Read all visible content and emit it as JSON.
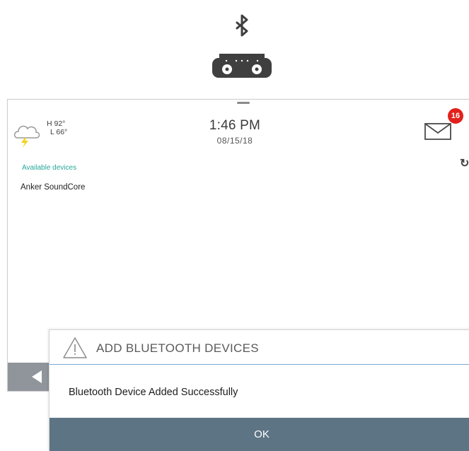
{
  "illustration": {
    "bluetooth_icon": "bluetooth-icon",
    "speaker_icon": "speaker-icon"
  },
  "header": {
    "weather": {
      "icon": "storm-cloud-icon",
      "high": "H 92°",
      "low": "L 66°"
    },
    "time": "1:46 PM",
    "date": "08/15/18",
    "messages": {
      "icon": "envelope-icon",
      "count": "16"
    }
  },
  "devices": {
    "label": "Available devices",
    "items": [
      "Anker SoundCore"
    ]
  },
  "dialog": {
    "icon": "warning-icon",
    "title": "ADD BLUETOOTH DEVICES",
    "message": "Bluetooth Device Added Successfully",
    "ok_label": "OK"
  },
  "colors": {
    "accent_teal": "#27a79a",
    "badge_red": "#e2211c",
    "ok_button": "#5d7485",
    "bottom_bar": "#8f959b"
  }
}
